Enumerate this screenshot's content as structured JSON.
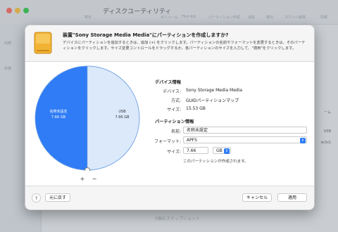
{
  "window": {
    "title": "ディスクユーティリティ",
    "toolbar_items": [
      "表示",
      "ボリューム",
      "First Aid",
      "パーティション作成",
      "消去",
      "復元",
      "マウント解除",
      "情報"
    ],
    "sidebar_labels": [
      "内部",
      "外部"
    ],
    "right_labels": [
      "ーム",
      "USB",
      "sk3s1"
    ],
    "status_text": "0個のスナップショット"
  },
  "dialog": {
    "title": "装置\"Sony Storage Media Media\"にパーティションを作成しますか?",
    "description": "デバイスにパーティションを追加するときは、追加 (+) をクリックします。パーティションの名前やフォーマットを変更するときは、そのパーティションをクリックします。サイズ変更コントロールをドラッグするか、各パーティションのサイズを入力して、\"適用\"をクリックします。",
    "pie": {
      "partitions": [
        {
          "name": "名称未設定",
          "size": "7.66 GB",
          "fraction": 0.5,
          "color": "#2f7cf6",
          "text_color": "#ffffff"
        },
        {
          "name": "USB",
          "size": "7.66 GB",
          "fraction": 0.5,
          "color": "#dbe9fb",
          "text_color": "#333333"
        }
      ],
      "add_label": "+",
      "remove_label": "−"
    },
    "device_info": {
      "section_title": "デバイス情報",
      "device_label": "デバイス:",
      "device_value": "Sony Storage Media Media",
      "scheme_label": "方式:",
      "scheme_value": "GUIDパーティションマップ",
      "size_label": "サイズ:",
      "size_value": "15.53 GB"
    },
    "partition_info": {
      "section_title": "パーティション情報",
      "name_label": "名前:",
      "name_value": "名称未設定",
      "format_label": "フォーマット:",
      "format_value": "APFS",
      "size_label": "サイズ:",
      "size_value": "7.66",
      "unit_value": "GB",
      "note": "このパーティションが作成されます。"
    },
    "buttons": {
      "help": "?",
      "revert": "元に戻す",
      "cancel": "キャンセル",
      "apply": "適用"
    }
  }
}
